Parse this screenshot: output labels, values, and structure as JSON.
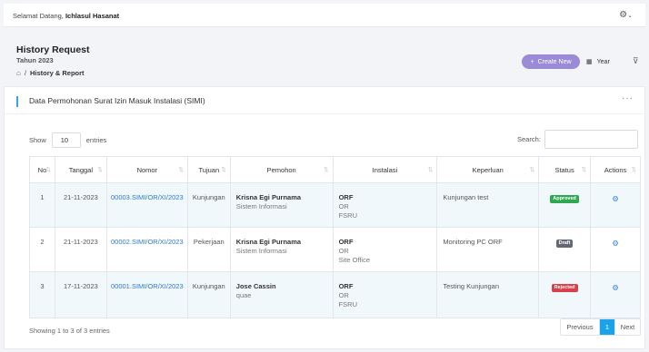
{
  "header": {
    "welcome_prefix": "Selamat Datang,",
    "user_name": "Ichlasul Hasanat"
  },
  "page": {
    "title": "History Request",
    "year": "Tahun 2023",
    "breadcrumb_separator": "/",
    "breadcrumb_current": "History & Report"
  },
  "toolbar": {
    "create_label": "Create New",
    "create_color": "#9b8ad6",
    "year_label": "Year"
  },
  "card": {
    "title": "Data Permohonan Surat Izin Masuk Instalasi (SIMI)",
    "more": "···"
  },
  "table_controls": {
    "show_label": "Show",
    "entries_value": "10",
    "entries_label": "entries",
    "search_label": "Search:",
    "search_value": ""
  },
  "columns": [
    "No",
    "Tanggal",
    "Nomor",
    "Tujuan",
    "Pemohon",
    "Instalasi",
    "Keperluan",
    "Status",
    "Actions"
  ],
  "rows": [
    {
      "no": "1",
      "tanggal": "21-11-2023",
      "nomor": "00003.SIMI/OR/XI/2023",
      "tujuan": "Kunjungan",
      "pemohon_name": "Krisna Egi Purnama",
      "pemohon_dept": "Sistem Informasi",
      "instalasi_main": "ORF",
      "instalasi_l2": "OR",
      "instalasi_l3": "FSRU",
      "keperluan": "Kunjungan test",
      "status": "Approved"
    },
    {
      "no": "2",
      "tanggal": "21-11-2023",
      "nomor": "00002.SIMI/OR/XI/2023",
      "tujuan": "Pekerjaan",
      "pemohon_name": "Krisna Egi Purnama",
      "pemohon_dept": "Sistem Informasi",
      "instalasi_main": "ORF",
      "instalasi_l2": "OR",
      "instalasi_l3": "Site Office",
      "keperluan": "Monitoring PC ORF",
      "status": "Draft"
    },
    {
      "no": "3",
      "tanggal": "17-11-2023",
      "nomor": "00001.SIMI/OR/XI/2023",
      "tujuan": "Kunjungan",
      "pemohon_name": "Jose Cassin",
      "pemohon_dept": "quae",
      "instalasi_main": "ORF",
      "instalasi_l2": "OR",
      "instalasi_l3": "FSRU",
      "keperluan": "Testing Kunjungan",
      "status": "Rejected"
    }
  ],
  "status_colors": {
    "Approved": "#2fa84f",
    "Draft": "#636872",
    "Rejected": "#d9414a"
  },
  "footer": {
    "showing": "Showing 1 to 3 of 3 entries",
    "prev": "Previous",
    "current_page": "1",
    "next": "Next"
  },
  "icons": {
    "settings": "gear-icon",
    "home": "home-icon",
    "calendar": "calendar-icon",
    "filter": "filter-icon",
    "action": "gear-icon"
  }
}
